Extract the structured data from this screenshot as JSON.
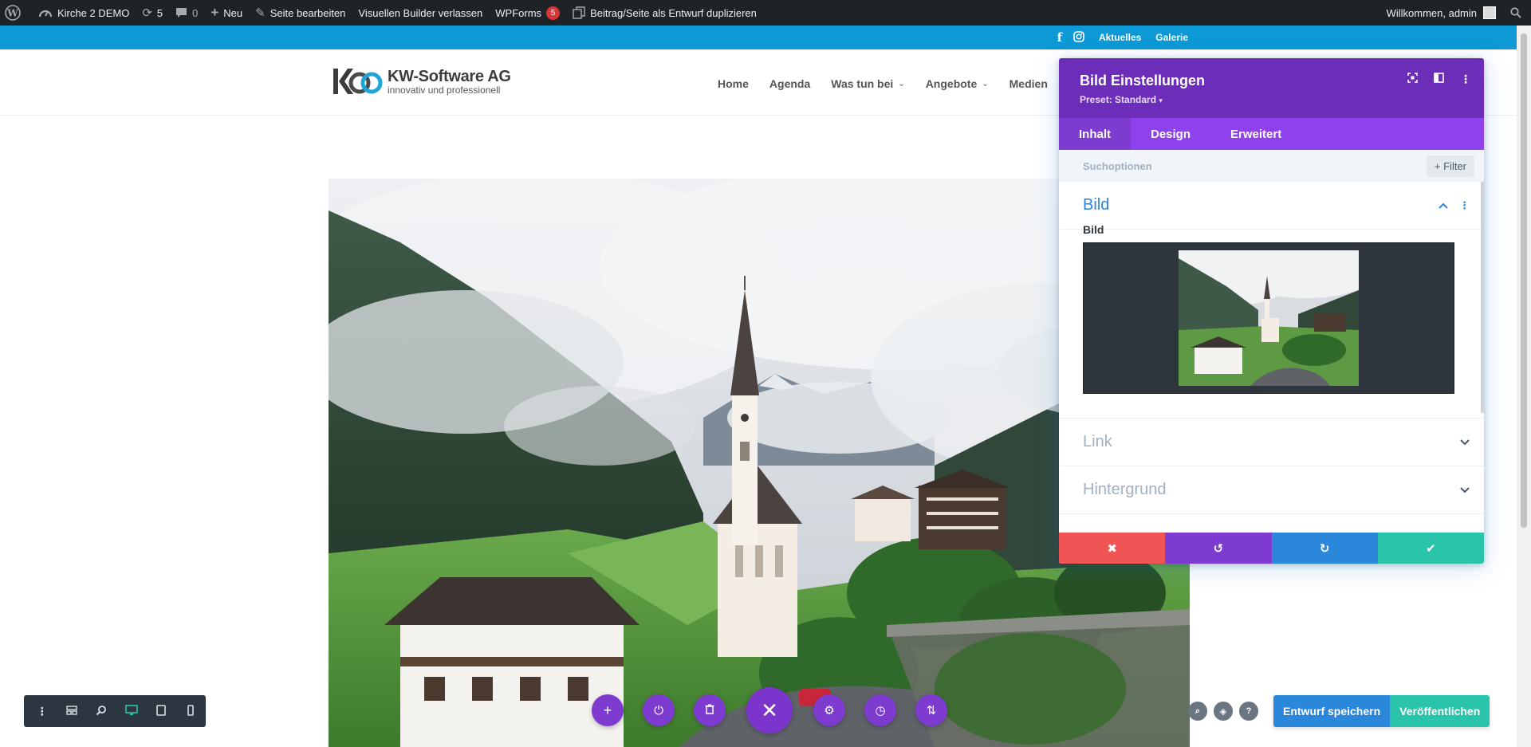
{
  "adminbar": {
    "site": "Kirche 2 DEMO",
    "updates": "5",
    "comments": "0",
    "new": "Neu",
    "edit_page": "Seite bearbeiten",
    "exit_builder": "Visuellen Builder verlassen",
    "wpforms": "WPForms",
    "wpforms_count": "5",
    "duplicate": "Beitrag/Seite als Entwurf duplizieren",
    "welcome": "Willkommen, admin"
  },
  "topbar": {
    "links": [
      "Aktuelles",
      "Galerie"
    ]
  },
  "logo": {
    "name": "KW-Software AG",
    "tagline": "innovativ und professionell"
  },
  "nav": {
    "items": [
      "Home",
      "Agenda",
      "Was tun bei",
      "Angebote",
      "Medien"
    ]
  },
  "panel": {
    "title": "Bild Einstellungen",
    "preset": "Preset: Standard",
    "tabs": [
      "Inhalt",
      "Design",
      "Erweitert"
    ],
    "search_placeholder": "Suchoptionen",
    "filter_label": "Filter",
    "sections": {
      "bild": "Bild",
      "bild_field": "Bild",
      "link": "Link",
      "hintergrund": "Hintergrund"
    }
  },
  "footer": {
    "save_draft": "Entwurf speichern",
    "publish": "Veröffentlichen"
  },
  "colors": {
    "admin_bar": "#1d2327",
    "top_bar": "#0c99d5",
    "panel_header": "#6c2eb9",
    "panel_tabs": "#8f42ec",
    "discard": "#ef5555",
    "undo": "#7e3bd0",
    "redo": "#2b87da",
    "save": "#29c4a9",
    "save_draft": "#2b87da",
    "publish": "#29c4a9"
  }
}
